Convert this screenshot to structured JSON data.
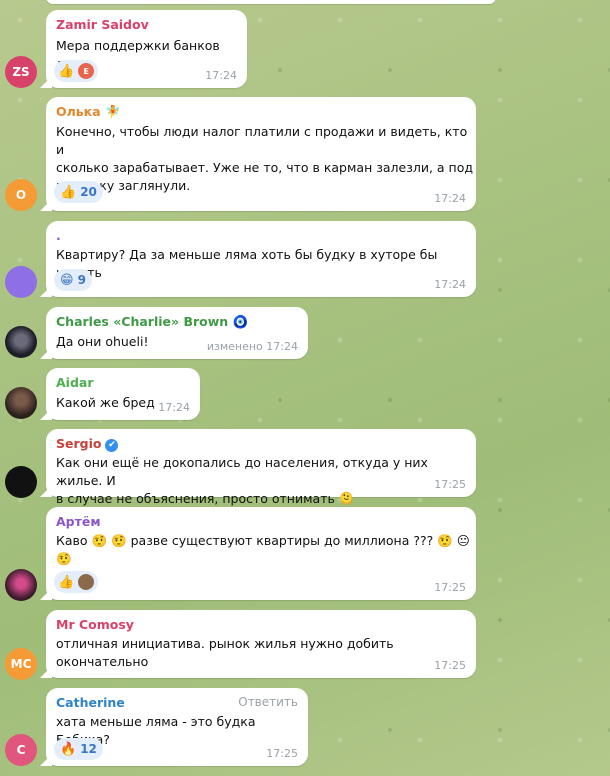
{
  "colors": {
    "zamir": "#d8416a",
    "olka": "#e2882b",
    "charles": "#3f9a45",
    "aidar": "#4caf50",
    "sergio": "#c8423a",
    "artem": "#8a57c9",
    "mrcomosy": "#d8416a",
    "catherine": "#2f83c9",
    "avatar_zs": "#d8416a",
    "avatar_o": "#f59b35",
    "avatar_violet": "#8e6fe6",
    "avatar_mc": "#f59b35",
    "avatar_c": "#e0567c"
  },
  "messages": {
    "zamir": {
      "sender": "Zamir Saidov",
      "avatar": "ZS",
      "text": "Мера поддержки банков лол",
      "reaction_emoji": "👍",
      "reaction_badge": "E",
      "time": "17:24"
    },
    "olka": {
      "sender": "Олька",
      "sender_emoji": "🧚",
      "avatar": "О",
      "lines": [
        "Конечно, чтобы люди налог платили с продажи и видеть, кто и",
        "сколько зарабатывает. Уже не то, что в карман залезли, а под",
        "подушку заглянули."
      ],
      "reaction_emoji": "👍",
      "reaction_count": "20",
      "time": "17:24"
    },
    "dot": {
      "sender": ".",
      "text": "Квартиру? Да за меньше ляма хоть бы будку в хуторе бы купить",
      "reaction_emoji": "😁",
      "reaction_count": "9",
      "time": "17:24"
    },
    "charles": {
      "sender": "Charles «Charlie» Brown",
      "sender_emoji": "🧿",
      "text": "Да они ohueli!",
      "time": "изменено 17:24"
    },
    "aidar": {
      "sender": "Aidar",
      "text": "Какой же бред",
      "time": "17:24"
    },
    "sergio": {
      "sender": "Sergio",
      "verified": "✔",
      "lines": [
        "Как они ещё не докопались до населения, откуда у них жилье. И",
        "в случае не объяснения, просто отнимать"
      ],
      "end_emoji": "🫠",
      "time": "17:25"
    },
    "artem": {
      "sender": "Артём",
      "line1": "Каво 🤨 🤨 разве существуют квартиры до миллиона ??? 🤨 😐",
      "line2": "🤨",
      "reaction_emoji": "👍",
      "time": "17:25"
    },
    "mrcomosy": {
      "sender": "Mr Comosy",
      "avatar": "MC",
      "lines": [
        "отличная инициатива. рынок жилья нужно добить",
        "окончательно"
      ],
      "time": "17:25"
    },
    "catherine": {
      "sender": "Catherine",
      "avatar": "C",
      "reply_label": "Ответить",
      "text": "хата меньше ляма - это будка Бобика?",
      "reaction_emoji": "🔥",
      "reaction_count": "12",
      "time": "17:25"
    }
  }
}
